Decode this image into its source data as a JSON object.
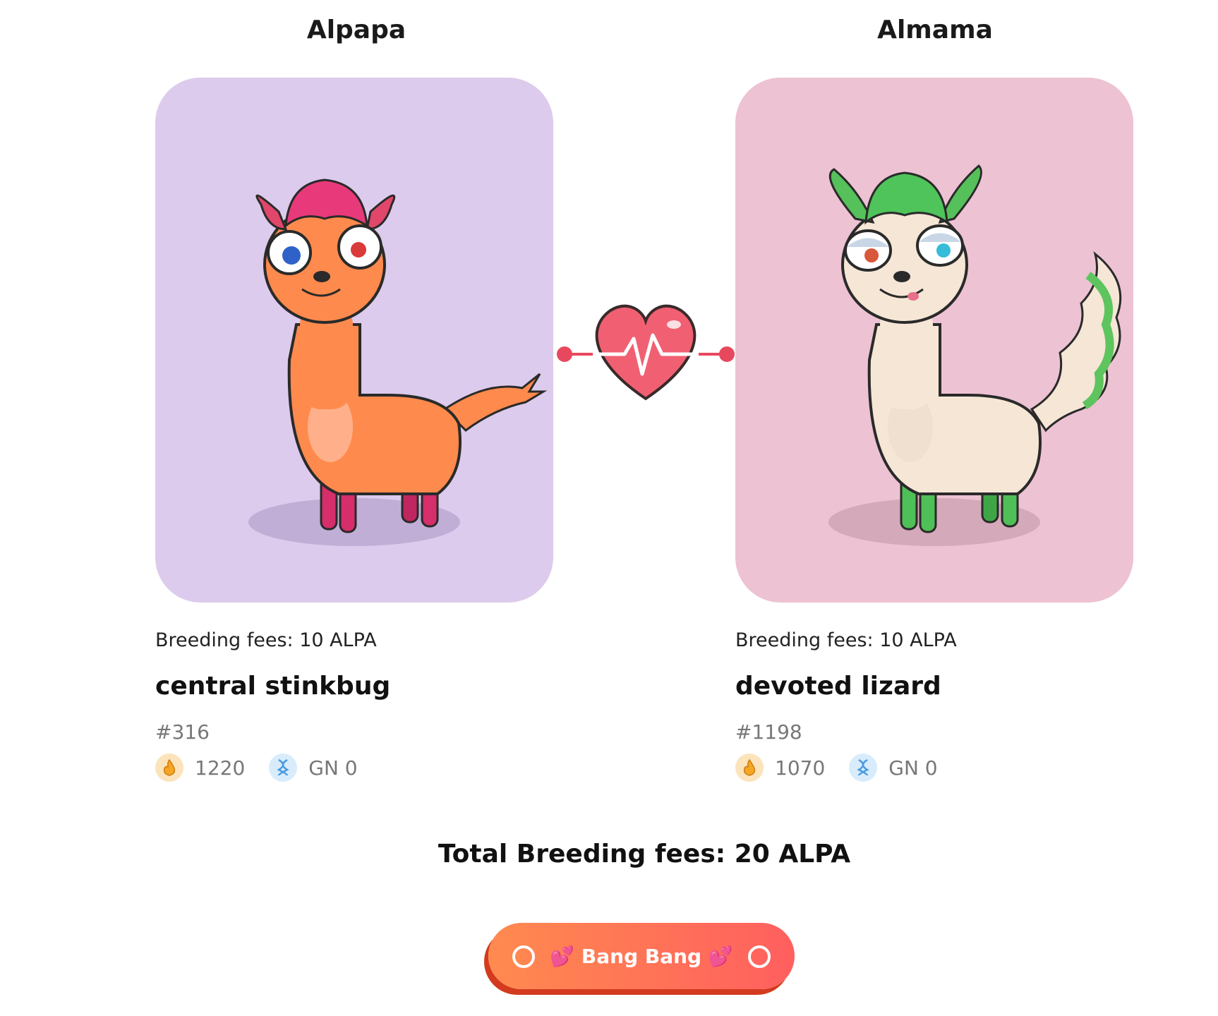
{
  "left": {
    "heading": "Alpapa",
    "fee_text": "Breeding fees: 10 ALPA",
    "name": "central stinkbug",
    "id": "#316",
    "energy": "1220",
    "generation": "GN 0",
    "card_color": "#dccbec"
  },
  "right": {
    "heading": "Almama",
    "fee_text": "Breeding fees: 10 ALPA",
    "name": "devoted lizard",
    "id": "#1198",
    "energy": "1070",
    "generation": "GN 0",
    "card_color": "#edc2d3"
  },
  "total_fee_text": "Total Breeding fees: 20 ALPA",
  "action_button": {
    "label": "💕 Bang Bang 💕"
  },
  "icons": {
    "energy": "fire-icon",
    "generation": "dna-icon",
    "center": "heartbeat-icon"
  },
  "colors": {
    "accent_start": "#ff8a4f",
    "accent_end": "#ff5f5f",
    "button_shadow": "#d33a1e",
    "heart": "#e8485e"
  }
}
